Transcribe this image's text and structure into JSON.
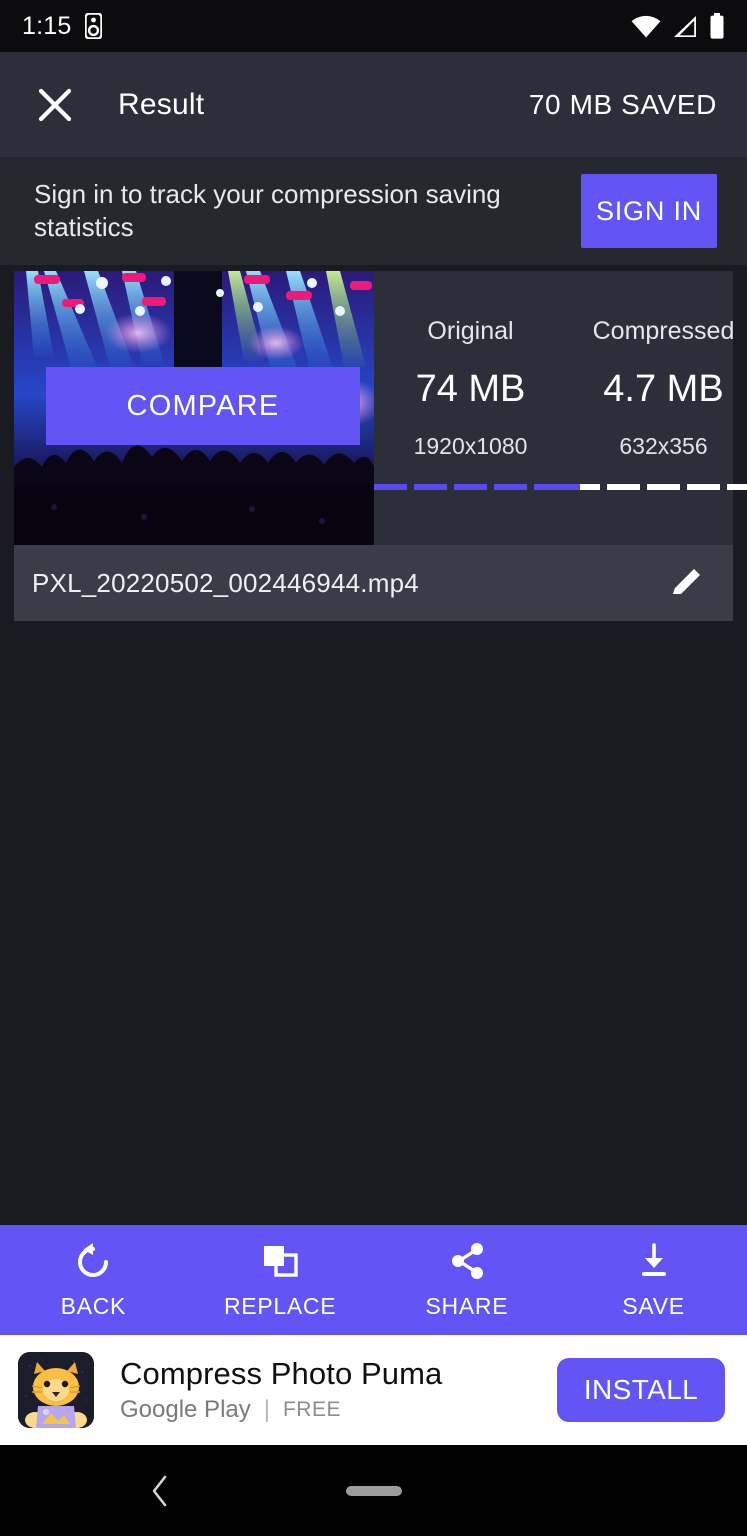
{
  "status_bar": {
    "time": "1:15",
    "icons": [
      "speaker-device-icon",
      "wifi-icon",
      "cellular-signal-icon",
      "battery-icon"
    ]
  },
  "app_bar": {
    "close_icon": "close-icon",
    "title": "Result",
    "saved_label": "70 MB SAVED"
  },
  "sign_in_banner": {
    "message": "Sign in to track your compression saving statistics",
    "button_label": "SIGN IN"
  },
  "result": {
    "compare_label": "COMPARE",
    "thumbnail_alt": "concert-stage-lights-thumbnail",
    "original": {
      "label": "Original",
      "size": "74 MB",
      "dimensions": "1920x1080",
      "segments_filled": 5,
      "segments_total": 5
    },
    "compressed": {
      "label": "Compressed",
      "size": "4.7 MB",
      "dimensions": "632x356",
      "segments_filled": 0.4,
      "segments_total": 5
    },
    "filename": "PXL_20220502_002446944.mp4",
    "edit_icon": "pencil-edit-icon"
  },
  "toolbar": {
    "items": [
      {
        "label": "BACK",
        "icon": "undo-rotate-icon"
      },
      {
        "label": "REPLACE",
        "icon": "copy-layers-icon"
      },
      {
        "label": "SHARE",
        "icon": "share-nodes-icon"
      },
      {
        "label": "SAVE",
        "icon": "download-icon"
      }
    ]
  },
  "ad": {
    "app_name": "Compress Photo Puma",
    "store": "Google Play",
    "divider": "|",
    "price": "FREE",
    "install_label": "INSTALL",
    "icon": "puma-app-icon"
  },
  "nav_bar": {
    "back_icon": "chevron-left-icon",
    "home_pill": "home-pill-handle"
  },
  "colors": {
    "accent_purple": "#6355f5",
    "background": "#1a1b20",
    "surface": "#2c2f3a",
    "filename_row": "#3a3d48",
    "status_bar": "#0c0c0e",
    "banner_white": "#ffffff"
  }
}
